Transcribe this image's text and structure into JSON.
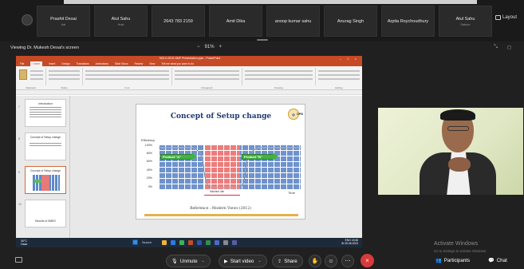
{
  "participants": [
    {
      "name": "Prashit Desai",
      "sub": "Aai"
    },
    {
      "name": "Atul Sahu",
      "sub": "Host"
    },
    {
      "name": "2643 783 2159",
      "sub": ""
    },
    {
      "name": "Amit Dika",
      "sub": ""
    },
    {
      "name": "anoop kumar sahu",
      "sub": ""
    },
    {
      "name": "Anurag Singh",
      "sub": ""
    },
    {
      "name": "Arpita Roychoudhury",
      "sub": ""
    },
    {
      "name": "Atul Sahu",
      "sub": "Saboor"
    }
  ],
  "view_button": "Layout",
  "viewing_label": "Viewing Dr. Mukesh Desai's screen",
  "zoom": {
    "minus": "−",
    "value": "91%",
    "plus": "+"
  },
  "viewbar_right": {
    "a": "⤡",
    "b": "◻"
  },
  "powerpoint": {
    "title": "NOLD-SDG-SMF Presentation.pptx - PowerPoint",
    "tabs": [
      "File",
      "Home",
      "Insert",
      "Design",
      "Transitions",
      "Animations",
      "Slide Show",
      "Review",
      "View",
      "Tell me what you want to do"
    ],
    "active_tab": "Home",
    "groups": [
      "Clipboard",
      "Slides",
      "Font",
      "Paragraph",
      "Drawing",
      "Editing"
    ],
    "thumbnails": [
      {
        "num": "7",
        "title": "Introduction"
      },
      {
        "num": "8",
        "title": "Concept of Setup change"
      },
      {
        "num": "9",
        "title": "Concept of Setup change"
      },
      {
        "num": "10",
        "title": "Results of SMED"
      }
    ],
    "status_left": "Slide 9 of 31",
    "status_notes": "Notes",
    "status_zoom": "61%"
  },
  "slide": {
    "title": "Concept of Setup change",
    "logo_text": "OPB",
    "ylabel": "Efficiency",
    "yticks": [
      "100%",
      "80%",
      "60%",
      "40%",
      "20%",
      "0%"
    ],
    "arrow_left": "Product \"A\"",
    "arrow_right": "Product \"B\"",
    "xlabel": "Time",
    "span_label": "Machine Idle",
    "reference": "Reference : Modern Views (2012)"
  },
  "taskbar": {
    "weather_top": "30°C",
    "weather_bottom": "Haze",
    "search": "Search",
    "lang": "ENG",
    "lang2": "IN",
    "time": "15:08",
    "date": "05-08-2023"
  },
  "activate": {
    "title": "Activate Windows",
    "sub": "Go to Settings to activate Windows."
  },
  "controls": {
    "unmute": "Unmute",
    "start_video": "Start video",
    "share": "Share",
    "participants": "Participants",
    "chat": "Chat"
  },
  "colors": {
    "ppt_orange": "#c64a26",
    "leave_red": "#d83a3a",
    "chart_blue": "#6e92cc",
    "chart_red": "#ed7c7c",
    "arrow_green": "#42b342"
  }
}
